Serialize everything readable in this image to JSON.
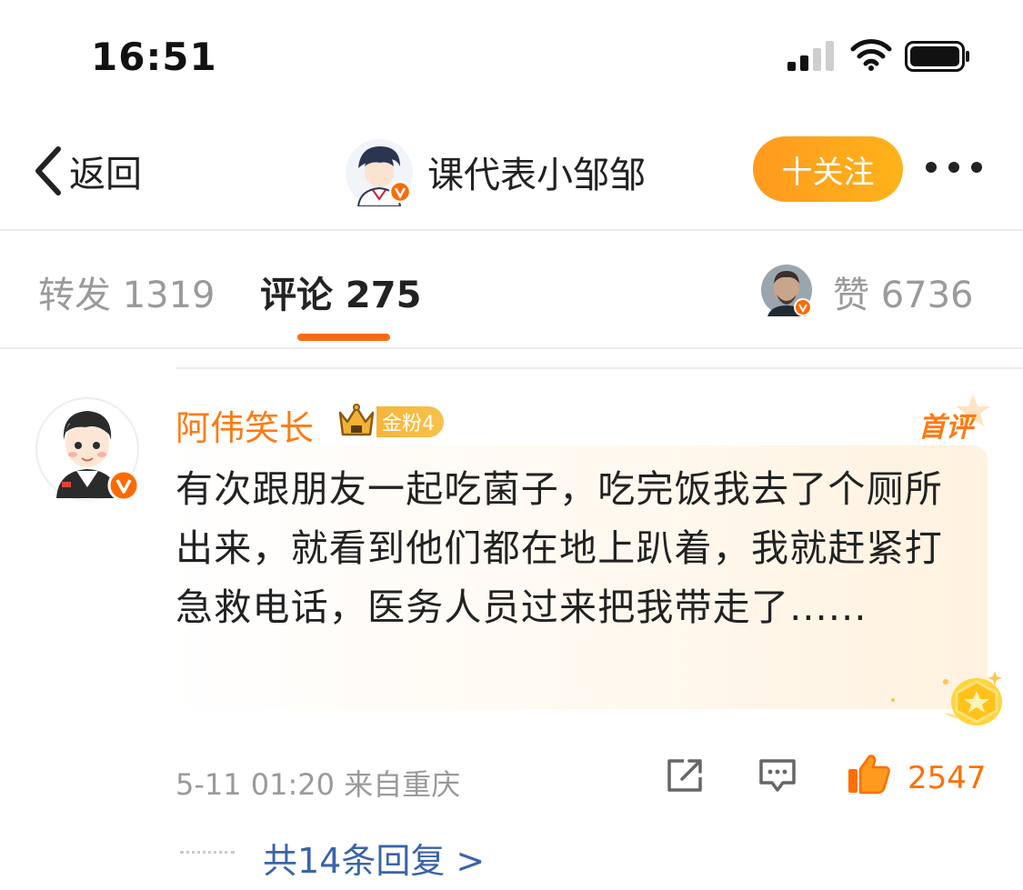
{
  "status_bar": {
    "time": "16:51"
  },
  "nav": {
    "back_label": "返回",
    "author_name": "课代表小邹邹",
    "follow_label": "十关注"
  },
  "tabs": {
    "repost": "转发 1319",
    "comment": "评论 275",
    "likes": "赞 6736"
  },
  "comment": {
    "author": "阿伟笑长",
    "fan_badge": "金粉4",
    "first_label": "首评",
    "text": "有次跟朋友一起吃菌子，吃完饭我去了个厕所出来，就看到他们都在地上趴着，我就赶紧打急救电话，医务人员过来把我带走了......",
    "meta": "5-11 01:20  来自重庆",
    "like_count": "2547",
    "replies_link": "共14条回复 >"
  },
  "colors": {
    "accent": "#ff7a12",
    "follow_button": "#ffa41c",
    "link": "#3a64a8",
    "verified": "#ff6a00"
  }
}
